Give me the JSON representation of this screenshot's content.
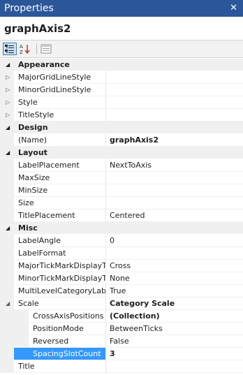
{
  "window": {
    "title": "Properties",
    "close_glyph": "✕"
  },
  "object_name": "graphAxis2",
  "toolbar": {
    "buttons": [
      "categorized-view-icon",
      "alphabetical-sort-icon",
      "property-pages-icon"
    ]
  },
  "rows": [
    {
      "type": "category",
      "name": "Appearance"
    },
    {
      "type": "property",
      "name": "MajorGridLineStyle",
      "value": "",
      "expandable": true
    },
    {
      "type": "property",
      "name": "MinorGridLineStyle",
      "value": "",
      "expandable": true
    },
    {
      "type": "property",
      "name": "Style",
      "value": "",
      "expandable": true
    },
    {
      "type": "property",
      "name": "TitleStyle",
      "value": "",
      "expandable": true
    },
    {
      "type": "category",
      "name": "Design"
    },
    {
      "type": "property",
      "name": "(Name)",
      "value": "graphAxis2",
      "bold": true
    },
    {
      "type": "category",
      "name": "Layout"
    },
    {
      "type": "property",
      "name": "LabelPlacement",
      "value": "NextToAxis"
    },
    {
      "type": "property",
      "name": "MaxSize",
      "value": ""
    },
    {
      "type": "property",
      "name": "MinSize",
      "value": ""
    },
    {
      "type": "property",
      "name": "Size",
      "value": ""
    },
    {
      "type": "property",
      "name": "TitlePlacement",
      "value": "Centered"
    },
    {
      "type": "category",
      "name": "Misc"
    },
    {
      "type": "property",
      "name": "LabelAngle",
      "value": "0"
    },
    {
      "type": "property",
      "name": "LabelFormat",
      "value": ""
    },
    {
      "type": "property",
      "name": "MajorTickMarkDisplayTy",
      "value": "Cross"
    },
    {
      "type": "property",
      "name": "MinorTickMarkDisplayTy",
      "value": "None"
    },
    {
      "type": "property",
      "name": "MultiLevelCategoryLabel",
      "value": "True"
    },
    {
      "type": "property",
      "name": "Scale",
      "value": "Category Scale",
      "bold": true,
      "expanded": true
    },
    {
      "type": "subproperty",
      "name": "CrossAxisPositions",
      "value": "(Collection)",
      "bold": true
    },
    {
      "type": "subproperty",
      "name": "PositionMode",
      "value": "BetweenTicks"
    },
    {
      "type": "subproperty",
      "name": "Reversed",
      "value": "False"
    },
    {
      "type": "subproperty",
      "name": "SpacingSlotCount",
      "value": "3",
      "bold": true,
      "selected": true
    },
    {
      "type": "property",
      "name": "Title",
      "value": ""
    }
  ],
  "colors": {
    "titlebar": "#2b579a",
    "selection": "#3399ff",
    "gutter": "#f0f0f0"
  }
}
